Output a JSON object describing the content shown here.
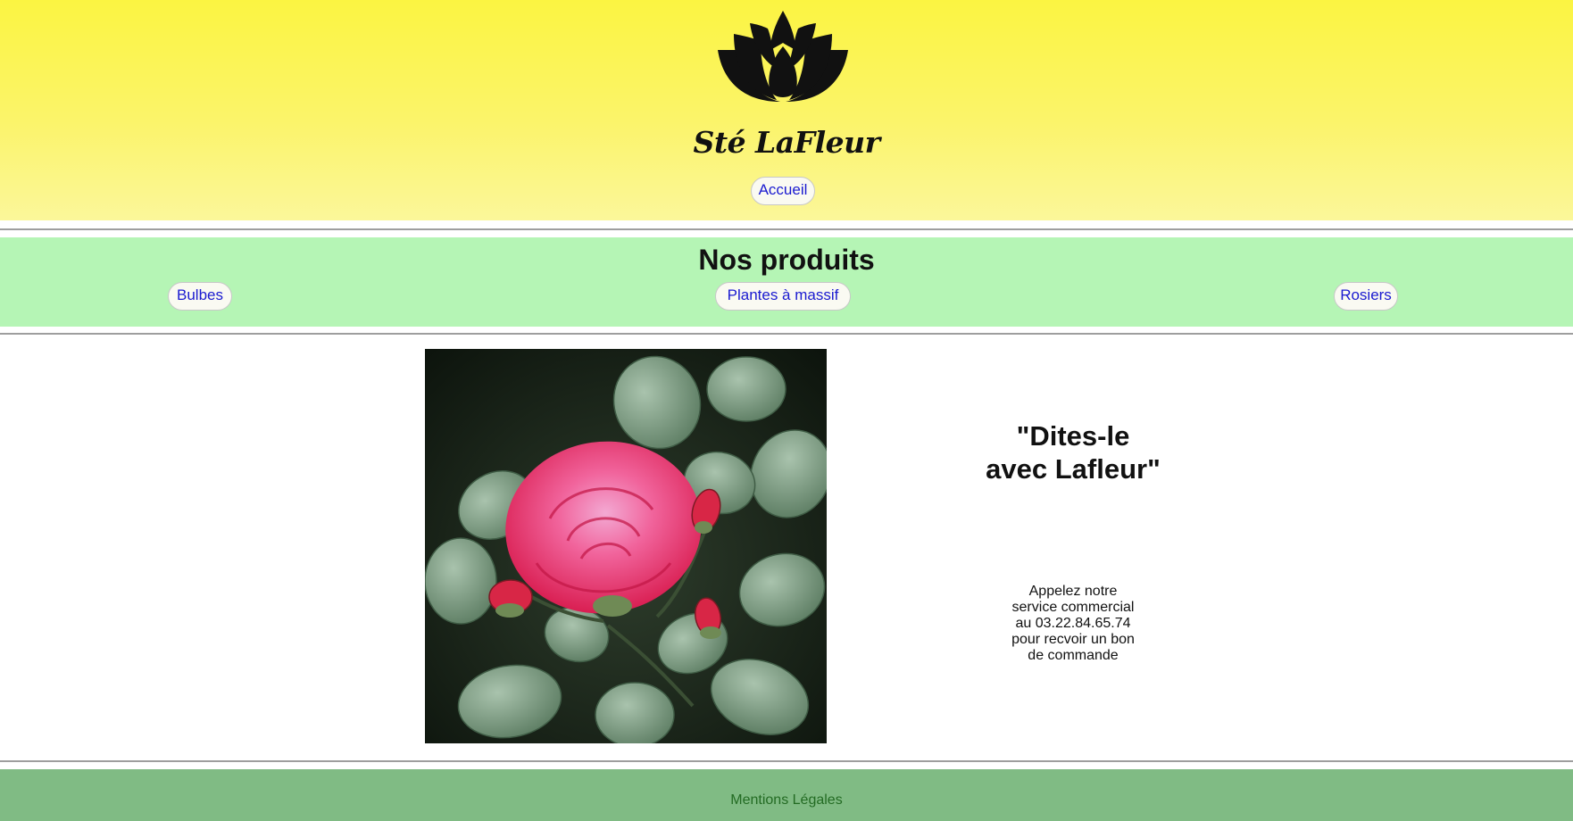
{
  "header": {
    "logo_icon": "lotus-flower-icon",
    "brand_name": "Sté LaFleur",
    "home_link": "Accueil",
    "background_color": "#fbf442"
  },
  "products": {
    "title": "Nos produits",
    "categories": [
      "Bulbes",
      "Plantes à massif",
      "Rosiers"
    ],
    "background_color": "#b5f5b5"
  },
  "main": {
    "image_subject": "red-rose-photo",
    "slogan": "\"Dites-le avec Lafleur\"",
    "contact": "Appelez notre service commercial au 03.22.84.65.74 pour recvoir un bon de commande"
  },
  "footer": {
    "legal_link": "Mentions Légales",
    "background_color": "#80bb84"
  }
}
